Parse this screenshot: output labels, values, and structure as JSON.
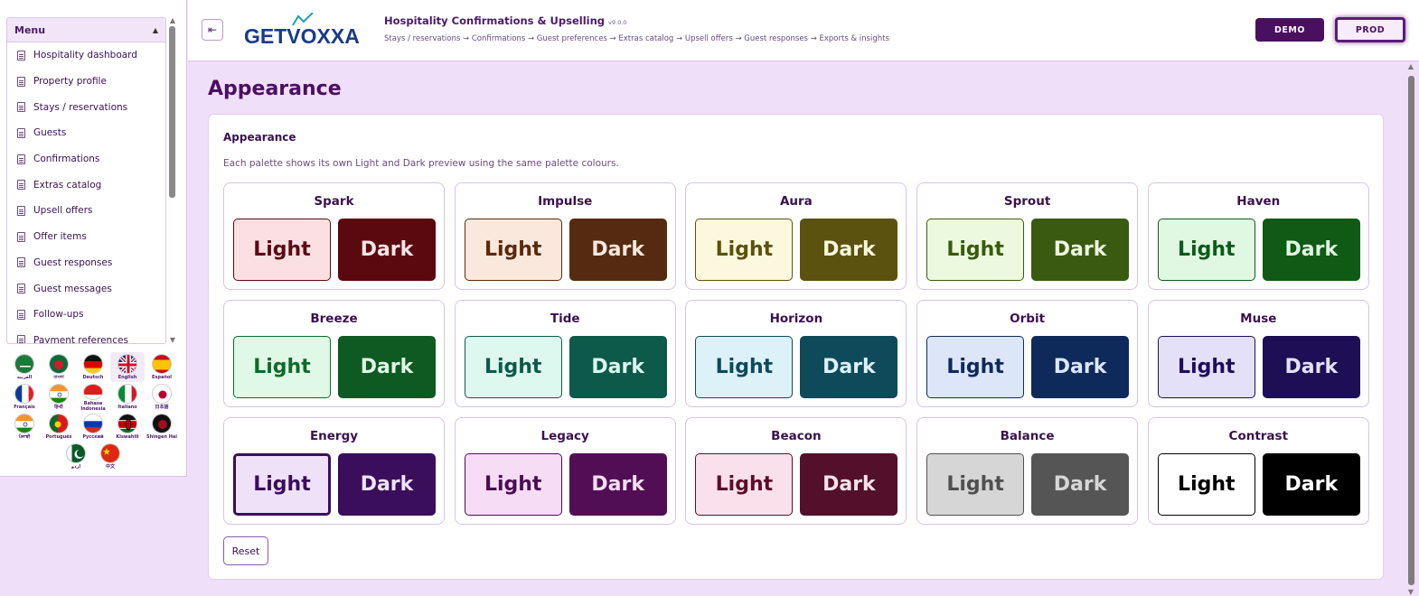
{
  "sidebar": {
    "menu_title": "Menu",
    "collapse_glyph": "▲",
    "items": [
      {
        "label": "Hospitality dashboard"
      },
      {
        "label": "Property profile"
      },
      {
        "label": "Stays / reservations"
      },
      {
        "label": "Guests"
      },
      {
        "label": "Confirmations"
      },
      {
        "label": "Extras catalog"
      },
      {
        "label": "Upsell offers"
      },
      {
        "label": "Offer items"
      },
      {
        "label": "Guest responses"
      },
      {
        "label": "Guest messages"
      },
      {
        "label": "Follow-ups"
      },
      {
        "label": "Payment references"
      }
    ],
    "languages": [
      {
        "label": "العربية",
        "icon": "flag-saudi-arabia-icon"
      },
      {
        "label": "বাংলা",
        "icon": "flag-bangladesh-icon"
      },
      {
        "label": "Deutsch",
        "icon": "flag-germany-icon"
      },
      {
        "label": "English",
        "icon": "flag-uk-icon",
        "active": true
      },
      {
        "label": "Español",
        "icon": "flag-spain-icon"
      },
      {
        "label": "Français",
        "icon": "flag-france-icon"
      },
      {
        "label": "हिन्दी",
        "icon": "flag-india-icon"
      },
      {
        "label": "Bahasa Indonesia",
        "icon": "flag-indonesia-icon"
      },
      {
        "label": "Italiano",
        "icon": "flag-italy-icon"
      },
      {
        "label": "日本語",
        "icon": "flag-japan-icon"
      },
      {
        "label": "ਪੰਜਾਬੀ",
        "icon": "flag-india-icon"
      },
      {
        "label": "Português",
        "icon": "flag-portugal-icon"
      },
      {
        "label": "Русский",
        "icon": "flag-russia-icon"
      },
      {
        "label": "Kiswahili",
        "icon": "flag-kenya-icon"
      },
      {
        "label": "Shingen Hai",
        "icon": "flag-dark-icon"
      },
      {
        "label": "اردو",
        "icon": "flag-pakistan-icon"
      },
      {
        "label": "中文",
        "icon": "flag-china-icon"
      }
    ]
  },
  "header": {
    "toggle_icon": "sidebar-collapse-icon",
    "logo_text": "GETVOXXA",
    "title": "Hospitality Confirmations & Upselling",
    "version": "v9.0.0",
    "workflow": "Stays / reservations → Confirmations → Guest preferences → Extras catalog → Upsell offers → Guest responses → Exports & insights",
    "demo_label": "DEMO",
    "prod_label": "PROD"
  },
  "page": {
    "title": "Appearance",
    "card_title": "Appearance",
    "description": "Each palette shows its own Light and Dark preview using the same palette colours.",
    "light_label": "Light",
    "dark_label": "Dark",
    "reset_label": "Reset",
    "selected_palette": "Energy",
    "selected_mode": "Light",
    "palettes": [
      {
        "name": "Spark",
        "light_bg": "#fbe0e3",
        "light_fg": "#5a0a14",
        "dark_bg": "#5a0a0f",
        "dark_fg": "#f8e4e6"
      },
      {
        "name": "Impulse",
        "light_bg": "#fbe8dc",
        "light_fg": "#5a2a0a",
        "dark_bg": "#552a10",
        "dark_fg": "#fbe8dc"
      },
      {
        "name": "Aura",
        "light_bg": "#fbf8de",
        "light_fg": "#5a520a",
        "dark_bg": "#5a520e",
        "dark_fg": "#fbf8de"
      },
      {
        "name": "Sprout",
        "light_bg": "#ecf9df",
        "light_fg": "#3a5a0e",
        "dark_bg": "#3a5a10",
        "dark_fg": "#ecf9df"
      },
      {
        "name": "Haven",
        "light_bg": "#e0f8e2",
        "light_fg": "#0e5a1a",
        "dark_bg": "#0f5a14",
        "dark_fg": "#e0f8e2"
      },
      {
        "name": "Breeze",
        "light_bg": "#e0f8e6",
        "light_fg": "#0e6a2a",
        "dark_bg": "#0e5a22",
        "dark_fg": "#e0f8e6"
      },
      {
        "name": "Tide",
        "light_bg": "#dcf8ef",
        "light_fg": "#0e5a48",
        "dark_bg": "#0e5a4a",
        "dark_fg": "#dcf8ef"
      },
      {
        "name": "Horizon",
        "light_bg": "#ddf1f8",
        "light_fg": "#0e4a5a",
        "dark_bg": "#0e4a5a",
        "dark_fg": "#ddf1f8"
      },
      {
        "name": "Orbit",
        "light_bg": "#dde6f8",
        "light_fg": "#0e2a5a",
        "dark_bg": "#0e2a5a",
        "dark_fg": "#dde6f8"
      },
      {
        "name": "Muse",
        "light_bg": "#e4e0f8",
        "light_fg": "#1e0e5a",
        "dark_bg": "#1e0e55",
        "dark_fg": "#e4e0f8"
      },
      {
        "name": "Energy",
        "light_bg": "#efe2f8",
        "light_fg": "#3a0e5a",
        "dark_bg": "#3a0e5a",
        "dark_fg": "#efe2f8"
      },
      {
        "name": "Legacy",
        "light_bg": "#f6dcf5",
        "light_fg": "#4a0e52",
        "dark_bg": "#520e55",
        "dark_fg": "#f6dcf5"
      },
      {
        "name": "Beacon",
        "light_bg": "#f9e0ea",
        "light_fg": "#5a0e2a",
        "dark_bg": "#52102a",
        "dark_fg": "#f9e0ea"
      },
      {
        "name": "Balance",
        "light_bg": "#d6d6d6",
        "light_fg": "#505050",
        "dark_bg": "#555555",
        "dark_fg": "#d6d6d6"
      },
      {
        "name": "Contrast",
        "light_bg": "#ffffff",
        "light_fg": "#000000",
        "dark_bg": "#000000",
        "dark_fg": "#ffffff"
      }
    ]
  }
}
